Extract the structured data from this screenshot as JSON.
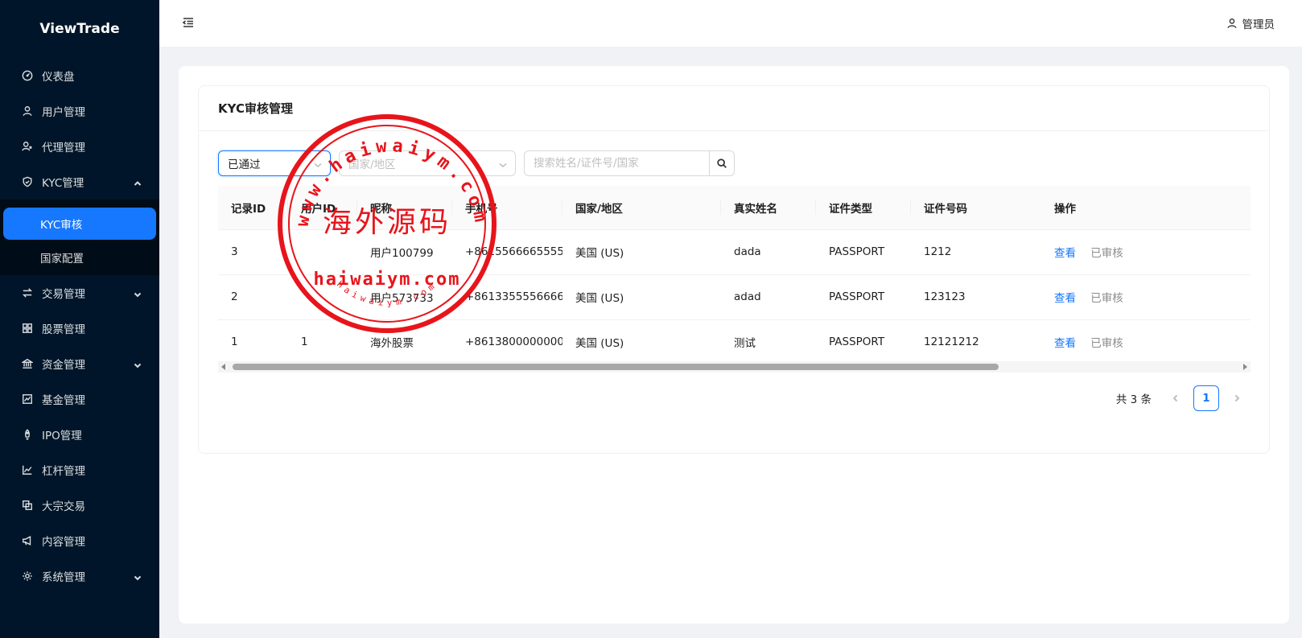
{
  "app": {
    "logo": "ViewTrade"
  },
  "sidebar": {
    "items": [
      {
        "label": "仪表盘",
        "icon": "dashboard-icon"
      },
      {
        "label": "用户管理",
        "icon": "user-icon"
      },
      {
        "label": "代理管理",
        "icon": "agent-icon"
      },
      {
        "label": "KYC管理",
        "icon": "shield-check-icon",
        "expanded": true,
        "children": [
          {
            "label": "KYC审核",
            "active": true
          },
          {
            "label": "国家配置"
          }
        ]
      },
      {
        "label": "交易管理",
        "icon": "exchange-icon",
        "has_children": true
      },
      {
        "label": "股票管理",
        "icon": "grid-icon"
      },
      {
        "label": "资金管理",
        "icon": "bank-icon",
        "has_children": true
      },
      {
        "label": "基金管理",
        "icon": "chart-icon"
      },
      {
        "label": "IPO管理",
        "icon": "rocket-icon"
      },
      {
        "label": "杠杆管理",
        "icon": "line-chart-icon"
      },
      {
        "label": "大宗交易",
        "icon": "block-icon"
      },
      {
        "label": "内容管理",
        "icon": "notification-icon"
      },
      {
        "label": "系统管理",
        "icon": "gear-icon",
        "has_children": true
      }
    ]
  },
  "header": {
    "user_label": "管理员"
  },
  "page": {
    "title": "KYC审核管理"
  },
  "filters": {
    "status_value": "已通过",
    "region_placeholder": "国家/地区",
    "search_placeholder": "搜索姓名/证件号/国家"
  },
  "table": {
    "columns": [
      "记录ID",
      "用户ID",
      "昵称",
      "手机号",
      "国家/地区",
      "真实姓名",
      "证件类型",
      "证件号码",
      "操作"
    ],
    "rows": [
      {
        "id": "3",
        "user_id": "",
        "nickname": "用户100799",
        "phone": "+8615566665555",
        "country": "美国 (US)",
        "real_name": "dada",
        "doc_type": "PASSPORT",
        "doc_no": "1212"
      },
      {
        "id": "2",
        "user_id": "",
        "nickname": "用户573733",
        "phone": "+8613355556666",
        "country": "美国 (US)",
        "real_name": "adad",
        "doc_type": "PASSPORT",
        "doc_no": "123123"
      },
      {
        "id": "1",
        "user_id": "1",
        "nickname": "海外股票",
        "phone": "+8613800000000",
        "country": "美国 (US)",
        "real_name": "测试",
        "doc_type": "PASSPORT",
        "doc_no": "12121212"
      }
    ],
    "action_view": "查看",
    "action_reviewed": "已审核"
  },
  "pagination": {
    "total_text": "共 3 条",
    "current_page": "1"
  },
  "watermark": {
    "outer_text": "www.haiwaiym.com",
    "center_text": "海外源码",
    "url_text": "haiwaiym.com",
    "inner_text": "haiwaiym.com",
    "color": "#e8141b"
  }
}
